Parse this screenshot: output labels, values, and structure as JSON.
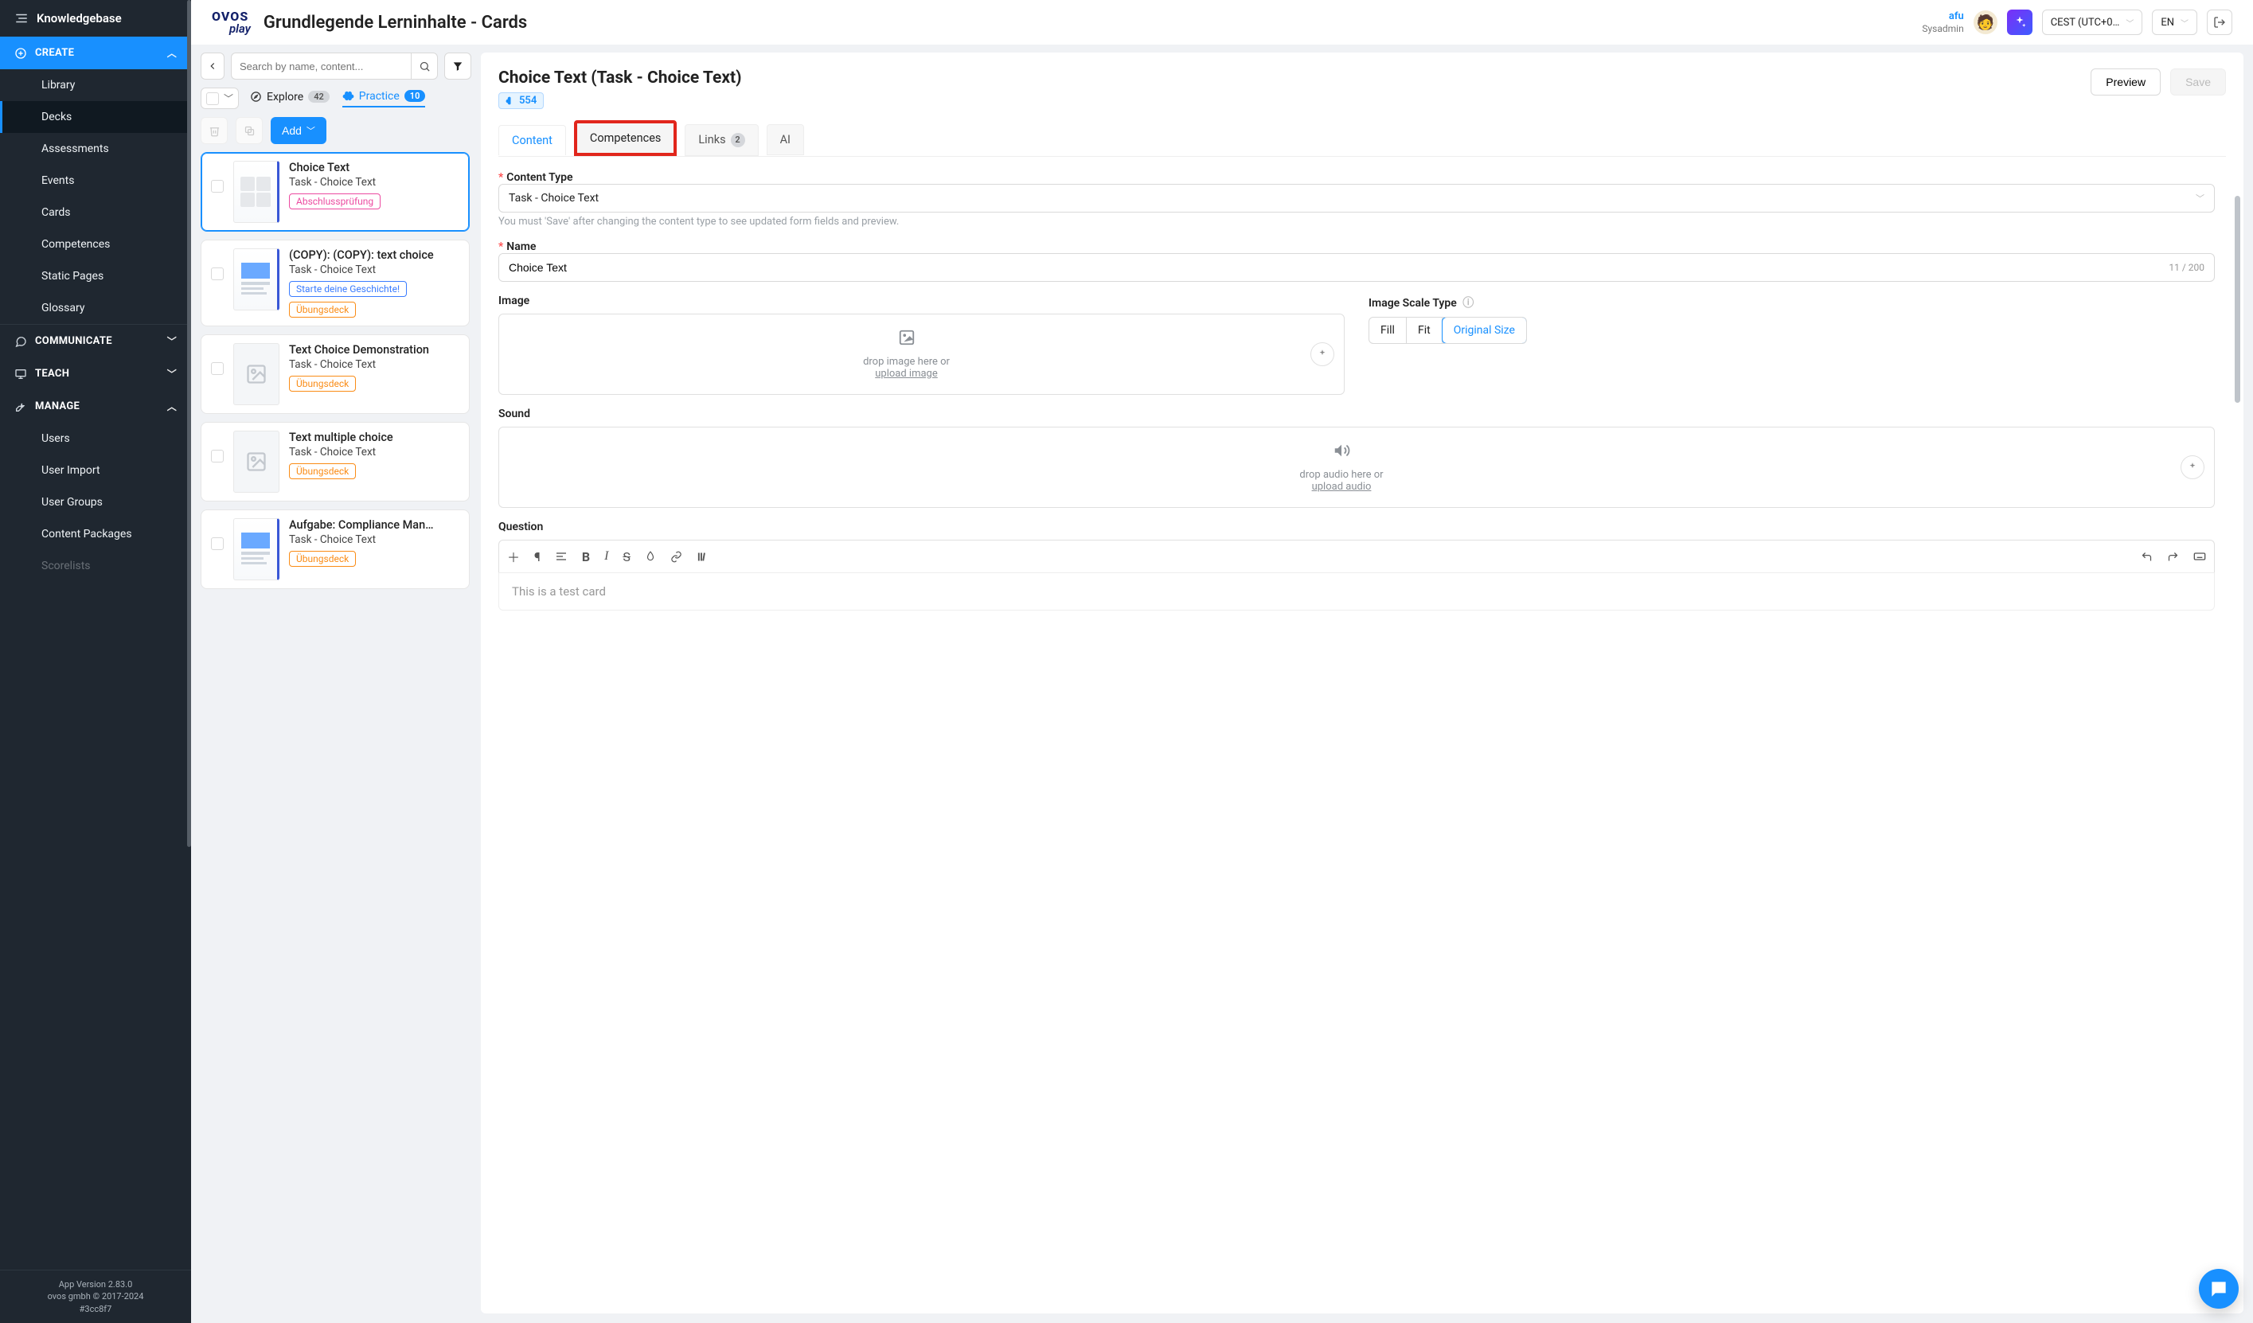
{
  "sidebar": {
    "header": "Knowledgebase",
    "sections": [
      {
        "id": "create",
        "label": "CREATE",
        "expanded": true,
        "color": "blue",
        "items": [
          {
            "id": "library",
            "label": "Library"
          },
          {
            "id": "decks",
            "label": "Decks",
            "active": true
          },
          {
            "id": "assessments",
            "label": "Assessments"
          },
          {
            "id": "events",
            "label": "Events"
          },
          {
            "id": "cards",
            "label": "Cards"
          },
          {
            "id": "competences",
            "label": "Competences"
          },
          {
            "id": "static-pages",
            "label": "Static Pages"
          },
          {
            "id": "glossary",
            "label": "Glossary"
          }
        ]
      },
      {
        "id": "communicate",
        "label": "COMMUNICATE",
        "expanded": false
      },
      {
        "id": "teach",
        "label": "TEACH",
        "expanded": false
      },
      {
        "id": "manage",
        "label": "MANAGE",
        "expanded": true,
        "items": [
          {
            "id": "users",
            "label": "Users"
          },
          {
            "id": "user-import",
            "label": "User Import"
          },
          {
            "id": "user-groups",
            "label": "User Groups"
          },
          {
            "id": "content-packages",
            "label": "Content Packages"
          },
          {
            "id": "scorelists",
            "label": "Scorelists"
          }
        ]
      }
    ],
    "footer": {
      "line1": "App Version 2.83.0",
      "line2": "ovos gmbh © 2017-2024",
      "line3": "#3cc8f7"
    }
  },
  "topbar": {
    "logo_l1": "OVOS",
    "logo_l2": "play",
    "title": "Grundlegende Lerninhalte - Cards",
    "user_name": "afu",
    "user_role": "Sysadmin",
    "timezone": "CEST (UTC+0…",
    "language": "EN"
  },
  "left_panel": {
    "search_placeholder": "Search by name, content...",
    "modes": {
      "explore_label": "Explore",
      "explore_count": "42",
      "practice_label": "Practice",
      "practice_count": "10"
    },
    "add_label": "Add",
    "cards": [
      {
        "title": "Choice Text",
        "subtitle": "Task - Choice Text",
        "tags": [
          {
            "text": "Abschlussprüfung",
            "color": "pink"
          }
        ],
        "selected": true,
        "thumb": "grid"
      },
      {
        "title": "(COPY): (COPY): text choice",
        "subtitle": "Task - Choice Text",
        "tags": [
          {
            "text": "Starte deine Geschichte!",
            "color": "blue"
          },
          {
            "text": "Übungsdeck",
            "color": "orange"
          }
        ],
        "thumb": "image"
      },
      {
        "title": "Text Choice Demonstration",
        "subtitle": "Task - Choice Text",
        "tags": [
          {
            "text": "Übungsdeck",
            "color": "orange"
          }
        ],
        "thumb": "placeholder"
      },
      {
        "title": "Text multiple choice",
        "subtitle": "Task - Choice Text",
        "tags": [
          {
            "text": "Übungsdeck",
            "color": "orange"
          }
        ],
        "thumb": "placeholder"
      },
      {
        "title": "Aufgabe: Compliance Man…",
        "subtitle": "Task - Choice Text",
        "tags": [
          {
            "text": "Übungsdeck",
            "color": "orange"
          }
        ],
        "thumb": "image"
      }
    ]
  },
  "right_panel": {
    "title": "Choice Text (Task - Choice Text)",
    "chip": "554",
    "preview_label": "Preview",
    "save_label": "Save",
    "tabs": {
      "content": "Content",
      "competences": "Competences",
      "links": "Links",
      "links_count": "2",
      "ai": "AI"
    },
    "form": {
      "content_type_label": "Content Type",
      "content_type_value": "Task - Choice Text",
      "content_type_help": "You must 'Save' after changing the content type to see updated form fields and preview.",
      "name_label": "Name",
      "name_value": "Choice Text",
      "name_counter": "11 / 200",
      "image_label": "Image",
      "image_scale_label": "Image Scale Type",
      "scale_fill": "Fill",
      "scale_fit": "Fit",
      "scale_original": "Original Size",
      "image_drop_hint": "drop image here or",
      "image_upload_link": "upload image",
      "sound_label": "Sound",
      "sound_drop_hint": "drop audio here or",
      "sound_upload_link": "upload audio",
      "question_label": "Question",
      "question_body": "This is a test card"
    }
  }
}
